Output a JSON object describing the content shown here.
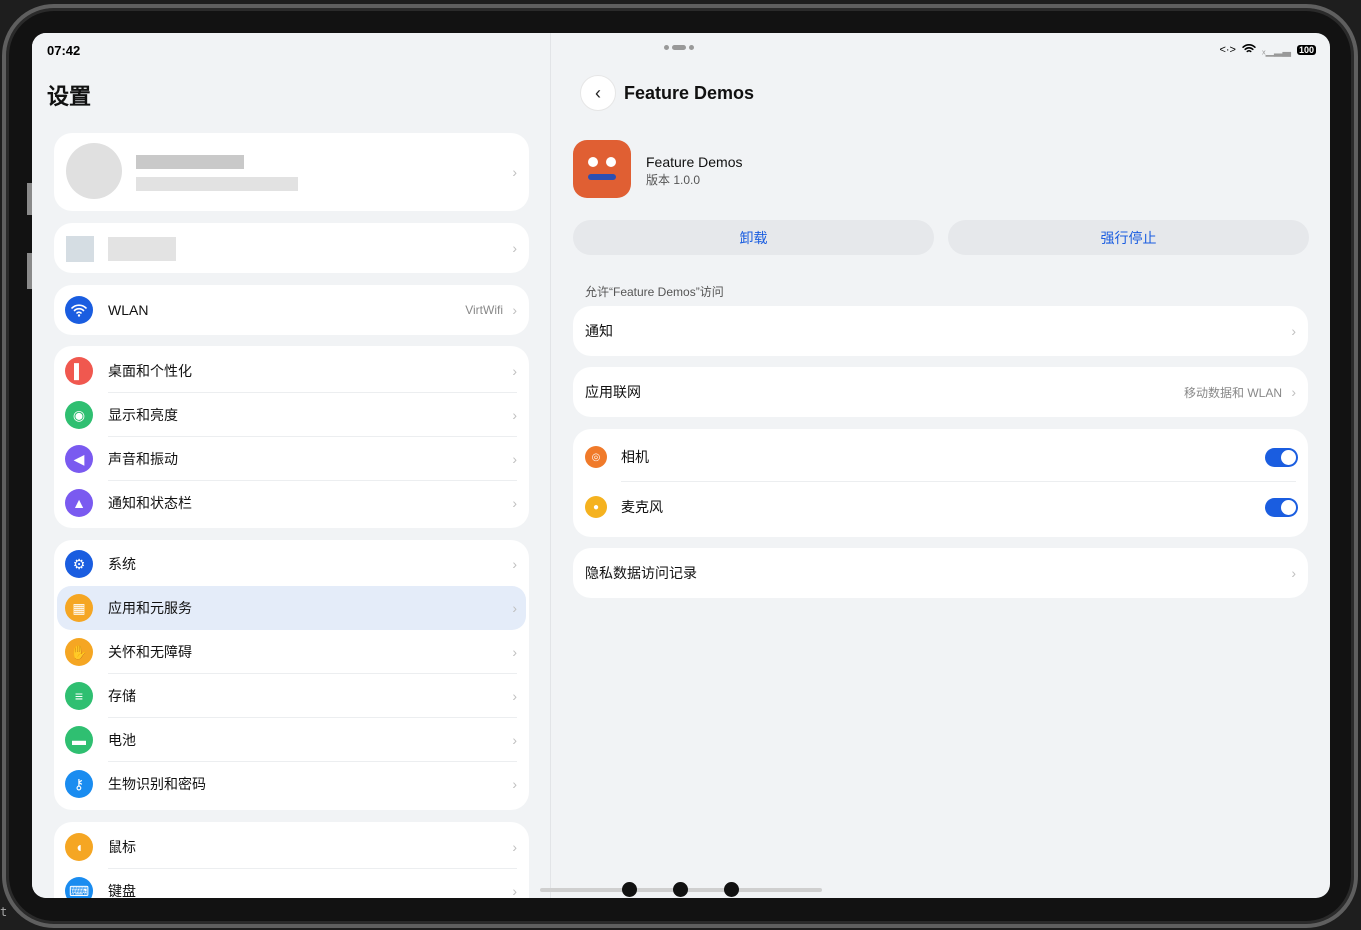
{
  "status_bar": {
    "time": "07:42",
    "battery": "100"
  },
  "settings": {
    "title": "设置",
    "wlan": {
      "label": "WLAN",
      "value": "VirtWifi"
    },
    "group1": [
      {
        "label": "桌面和个性化",
        "icon": "paintbrush-icon",
        "color": "#f0584f"
      },
      {
        "label": "显示和亮度",
        "icon": "eye-icon",
        "color": "#2fbf71"
      },
      {
        "label": "声音和振动",
        "icon": "speaker-icon",
        "color": "#7a5af0"
      },
      {
        "label": "通知和状态栏",
        "icon": "bell-icon",
        "color": "#7a5af0"
      }
    ],
    "group2": [
      {
        "label": "系统",
        "icon": "gear-icon",
        "color": "#1a5de0"
      },
      {
        "label": "应用和元服务",
        "icon": "apps-icon",
        "color": "#f5a623"
      },
      {
        "label": "关怀和无障碍",
        "icon": "hand-icon",
        "color": "#f5a623"
      },
      {
        "label": "存储",
        "icon": "storage-icon",
        "color": "#2fbf71"
      },
      {
        "label": "电池",
        "icon": "battery-icon",
        "color": "#2fbf71"
      },
      {
        "label": "生物识别和密码",
        "icon": "key-icon",
        "color": "#1a8cf0"
      }
    ],
    "group3": [
      {
        "label": "鼠标",
        "icon": "mouse-icon",
        "color": "#f5a623"
      },
      {
        "label": "键盘",
        "icon": "keyboard-icon",
        "color": "#1a8cf0"
      }
    ]
  },
  "detail": {
    "title": "Feature Demos",
    "app_name": "Feature Demos",
    "app_version": "版本 1.0.0",
    "uninstall": "卸载",
    "force_stop": "强行停止",
    "section_label": "允许“Feature Demos”访问",
    "notification": "通知",
    "network": {
      "label": "应用联网",
      "value": "移动数据和 WLAN"
    },
    "camera": {
      "label": "相机",
      "enabled": true
    },
    "microphone": {
      "label": "麦克风",
      "enabled": true
    },
    "privacy_log": "隐私数据访问记录"
  },
  "terminal_fragment": "t"
}
